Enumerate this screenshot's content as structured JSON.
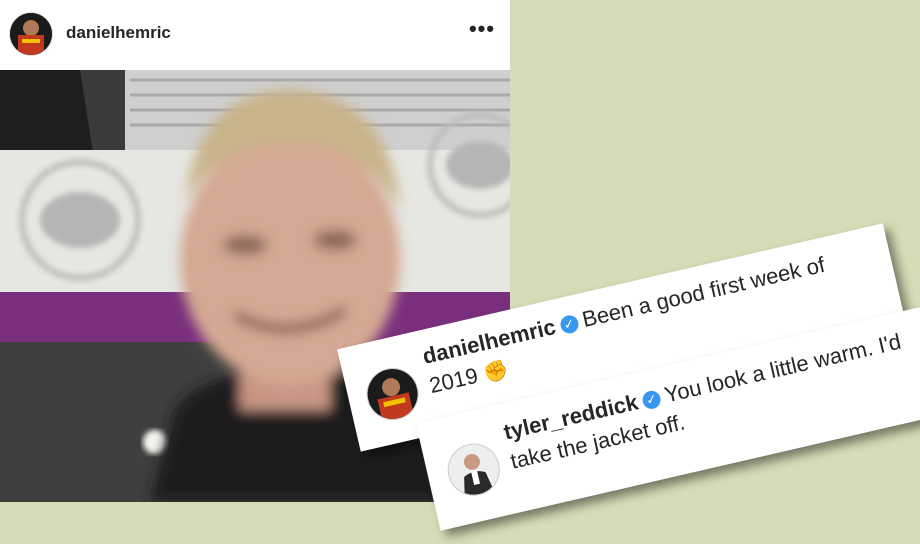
{
  "post": {
    "username": "danielhemric",
    "more_label": "•••"
  },
  "comments": [
    {
      "username": "danielhemric",
      "verified_icon": "verified-badge-icon",
      "text": "Been a good first week of 2019",
      "emoji": "✊",
      "emoji_name": "fist-icon"
    },
    {
      "username": "tyler_reddick",
      "verified_icon": "verified-badge-icon",
      "text": "You look a little warm. I'd take the jacket off."
    }
  ],
  "colors": {
    "background": "#d5dcb6",
    "verified": "#3897f0",
    "text": "#262626"
  }
}
